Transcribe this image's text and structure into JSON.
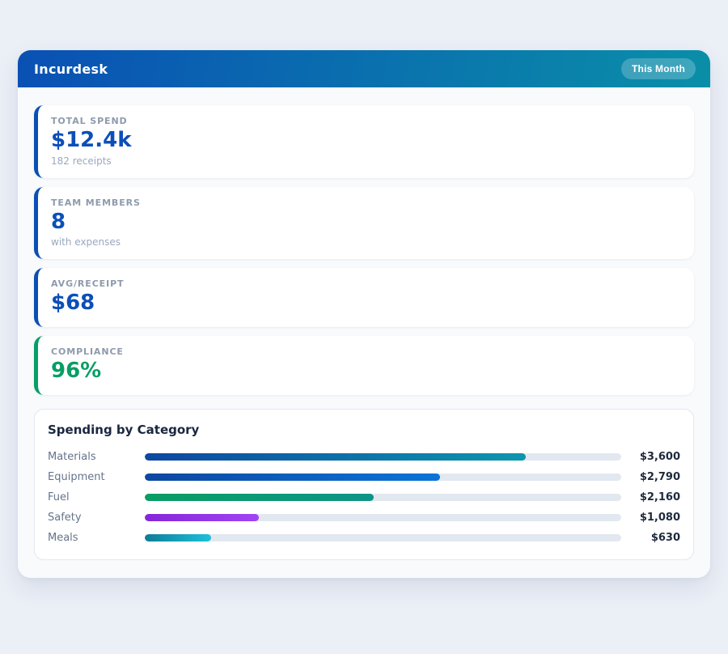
{
  "header": {
    "title": "Incurdesk",
    "badge": "This Month"
  },
  "colors": {
    "header_gradient_from": "#0a50b4",
    "header_gradient_to": "#0a8fa8",
    "accent_blue": "#0b4fb3",
    "accent_green": "#089e66",
    "track": "#e2e8f0"
  },
  "stats": [
    {
      "label": "TOTAL SPEND",
      "value": "$12.4k",
      "sub": "182 receipts",
      "accent": "#0b4fb3",
      "value_color": "#0c4fb8"
    },
    {
      "label": "TEAM MEMBERS",
      "value": "8",
      "sub": "with expenses",
      "accent": "#0b4fb3",
      "value_color": "#0c4fb8"
    },
    {
      "label": "AVG/RECEIPT",
      "value": "$68",
      "sub": "",
      "accent": "#0b4fb3",
      "value_color": "#0c4fb8"
    },
    {
      "label": "COMPLIANCE",
      "value": "96%",
      "sub": "",
      "accent": "#089e66",
      "value_color": "#089e66"
    }
  ],
  "chart": {
    "title": "Spending by Category"
  },
  "chart_data": {
    "type": "bar",
    "orientation": "horizontal",
    "title": "Spending by Category",
    "categories": [
      "Materials",
      "Equipment",
      "Fuel",
      "Safety",
      "Meals"
    ],
    "values": [
      3600,
      2790,
      2160,
      1080,
      630
    ],
    "value_labels": [
      "$3,600",
      "$2,790",
      "$2,160",
      "$1,080",
      "$630"
    ],
    "xlim": [
      0,
      4500
    ],
    "grid": false,
    "legend": false,
    "bar_colors": [
      [
        "#0d47a1",
        "#0c96ae"
      ],
      [
        "#0d47a1",
        "#0b74d8"
      ],
      [
        "#0a9d63",
        "#0e9488"
      ],
      [
        "#8527d8",
        "#a044f5"
      ],
      [
        "#0c7d97",
        "#1fc0da"
      ]
    ]
  }
}
